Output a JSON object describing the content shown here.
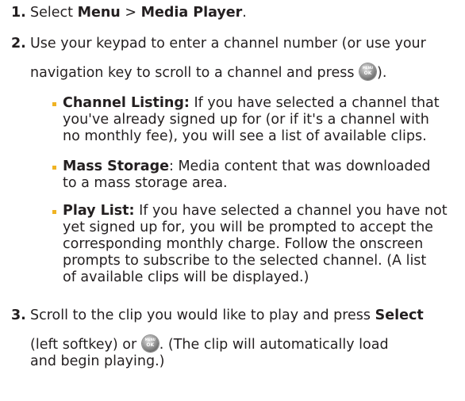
{
  "steps": [
    {
      "number": "1.",
      "parts": [
        "Select ",
        "Menu",
        " > ",
        "Media Player",
        "."
      ]
    },
    {
      "number": "2.",
      "line1": "Use your keypad to enter a channel number (or use your",
      "line2_before": "navigation key to scroll to a channel and press ",
      "line2_after": ")."
    },
    {
      "number": "3.",
      "line1_before": "Scroll to the clip you would like to play and press ",
      "line1_bold": "Select",
      "line2_before": "(left softkey) or ",
      "line2_after": ". (The clip will automatically load",
      "line3": "and begin playing.)"
    }
  ],
  "bullets": [
    {
      "term": "Channel Listing:",
      "lines": [
        " If you have selected a channel that",
        "you've already signed up for (or if it's a channel with",
        "no monthly fee), you will see a list of available clips."
      ]
    },
    {
      "term": "Mass Storage",
      "lines": [
        ": Media content that was downloaded",
        "to a mass storage area."
      ]
    },
    {
      "term": "Play List:",
      "lines": [
        " If you have selected a channel you have not",
        "yet signed up for, you will be prompted to accept the",
        "corresponding monthly charge. Follow the onscreen",
        "prompts to subscribe to the selected channel. (A list",
        "of available clips will be displayed.)"
      ]
    }
  ],
  "icons": {
    "menu_ok_key": "menu-ok-key-icon"
  },
  "colors": {
    "text": "#231f20",
    "bullet": "#f0b323"
  }
}
